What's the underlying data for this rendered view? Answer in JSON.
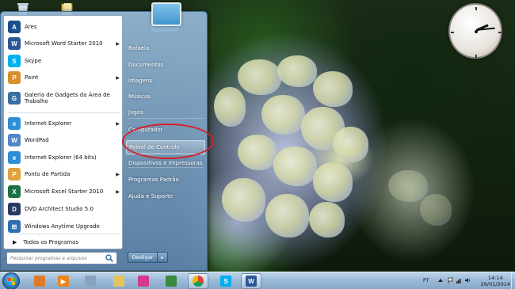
{
  "start_menu": {
    "programs": [
      {
        "label": "Ares",
        "icon": "ares-icon",
        "color": "#1a4f8a",
        "glyph": "A",
        "submenu": false
      },
      {
        "label": "Microsoft Word Starter 2010",
        "icon": "word-icon",
        "color": "#2b5797",
        "glyph": "W",
        "submenu": true
      },
      {
        "label": "Skype",
        "icon": "skype-icon",
        "color": "#00aff0",
        "glyph": "S",
        "submenu": false
      },
      {
        "label": "Paint",
        "icon": "paint-icon",
        "color": "#d98e2c",
        "glyph": "P",
        "submenu": true
      },
      {
        "label": "Galeria de Gadgets da Área de Trabalho",
        "icon": "gadgets-icon",
        "color": "#3a6fa3",
        "glyph": "G",
        "submenu": false
      },
      {
        "label": "Internet Explorer",
        "icon": "internet-explorer-icon",
        "color": "#2e8ed6",
        "glyph": "e",
        "submenu": true
      },
      {
        "label": "WordPad",
        "icon": "wordpad-icon",
        "color": "#4f87c6",
        "glyph": "W",
        "submenu": false
      },
      {
        "label": "Internet Explorer (64 bits)",
        "icon": "internet-explorer-64-icon",
        "color": "#2e8ed6",
        "glyph": "e",
        "submenu": false
      },
      {
        "label": "Ponto de Partida",
        "icon": "getting-started-icon",
        "color": "#e2a13a",
        "glyph": "P",
        "submenu": true
      },
      {
        "label": "Microsoft Excel Starter 2010",
        "icon": "excel-icon",
        "color": "#1e7145",
        "glyph": "X",
        "submenu": true
      },
      {
        "label": "DVD Architect Studio 5.0",
        "icon": "dvd-architect-icon",
        "color": "#2a3a66",
        "glyph": "D",
        "submenu": false
      },
      {
        "label": "Windows Anytime Upgrade",
        "icon": "windows-upgrade-icon",
        "color": "#2f6fb0",
        "glyph": "⊞",
        "submenu": false
      }
    ],
    "all_programs": "Todos os Programas",
    "search_placeholder": "Pesquisar programas e arquivos",
    "places": [
      "Rafaela",
      "Documentos",
      "Imagens",
      "Músicas",
      "Jogos",
      "Computador",
      "Painel de Controle",
      "Dispositivos e Impressoras",
      "Programas Padrão",
      "Ajuda e Suporte"
    ],
    "highlighted_place": "Painel de Controle",
    "shutdown_label": "Desligar",
    "shutdown_arrow": "▸"
  },
  "taskbar": {
    "pinned": [
      {
        "name": "media-center-icon",
        "color": "#e07a2a",
        "glyph": ""
      },
      {
        "name": "media-player-icon",
        "color": "#e8871e",
        "glyph": "▶"
      },
      {
        "name": "calculator-icon",
        "color": "#8aa4bf",
        "glyph": ""
      },
      {
        "name": "explorer-folder-icon",
        "color": "#e6c35a",
        "glyph": ""
      },
      {
        "name": "color-wheel-icon",
        "color": "#d43a8c",
        "glyph": ""
      },
      {
        "name": "solitaire-icon",
        "color": "#3b8a3b",
        "glyph": ""
      },
      {
        "name": "chrome-icon",
        "color": "#db4437",
        "glyph": "",
        "active": true
      },
      {
        "name": "skype-taskbar-icon",
        "color": "#00aff0",
        "glyph": "S"
      },
      {
        "name": "word-taskbar-icon",
        "color": "#2b5797",
        "glyph": "W",
        "active": true
      }
    ],
    "language": "PT",
    "time": "14:14",
    "date": "29/01/2014"
  },
  "clock_gadget": {
    "hour": 2,
    "minute": 14
  }
}
